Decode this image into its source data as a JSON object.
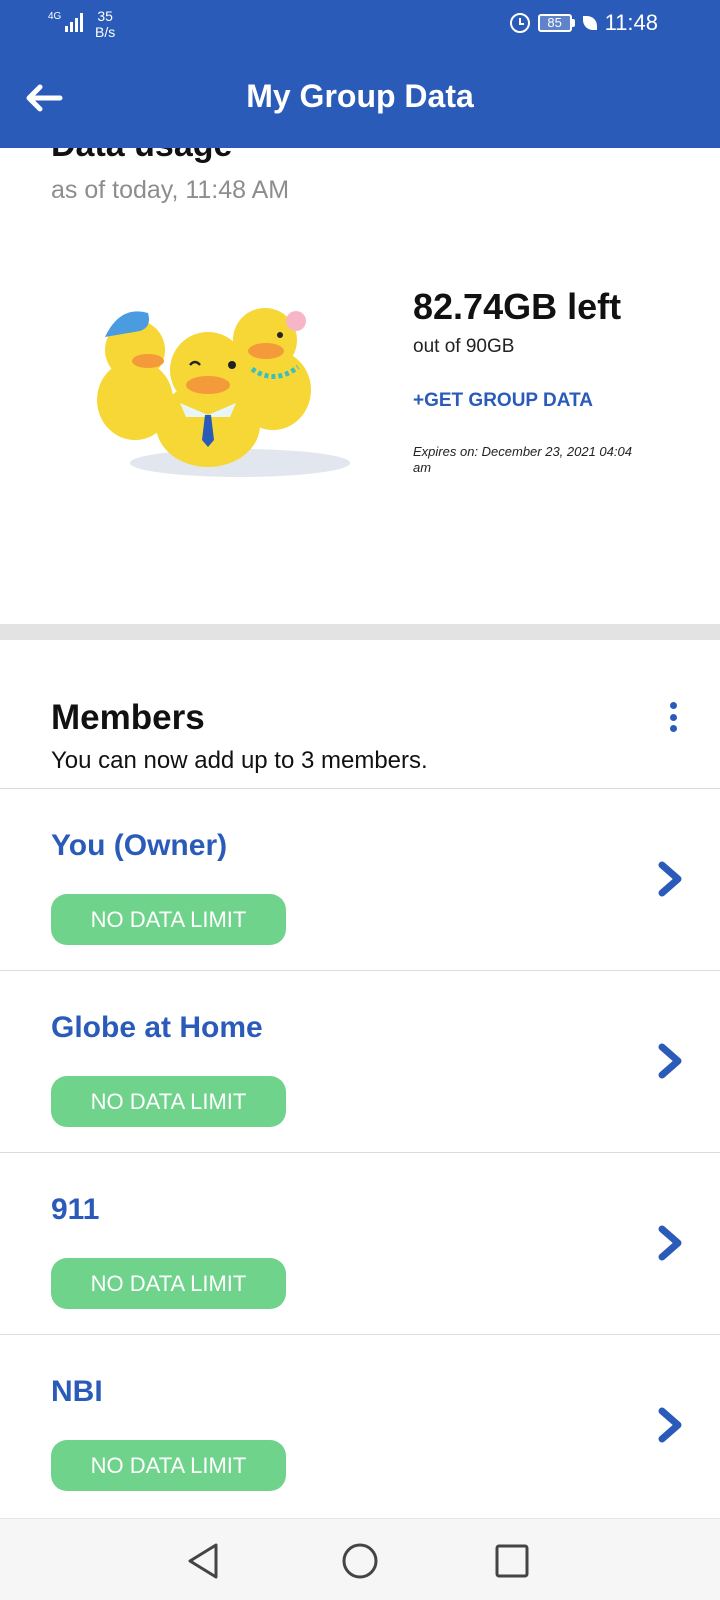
{
  "status_bar": {
    "network": "4G",
    "speed_value": "35",
    "speed_unit": "B/s",
    "battery": "85",
    "time": "11:48"
  },
  "app_bar": {
    "title": "My Group Data",
    "back_icon": "back-arrow-icon"
  },
  "usage": {
    "heading": "Data usage",
    "as_of": "as of today, 11:48 AM",
    "remaining": "82.74GB left",
    "total": "out of 90GB",
    "get_group_data": "+GET GROUP DATA",
    "expires": "Expires on: December 23, 2021 04:04 am"
  },
  "members": {
    "title": "Members",
    "subtitle": "You can now add up to 3 members.",
    "menu_icon": "more-vert-icon",
    "items": [
      {
        "name": "You (Owner)",
        "limit": "NO DATA LIMIT"
      },
      {
        "name": "Globe at Home",
        "limit": "NO DATA LIMIT"
      },
      {
        "name": "911",
        "limit": "NO DATA LIMIT"
      },
      {
        "name": "NBI",
        "limit": "NO DATA LIMIT"
      }
    ]
  },
  "nav": {
    "icons": [
      "back-triangle-icon",
      "home-circle-icon",
      "recents-square-icon"
    ]
  },
  "colors": {
    "brand_blue": "#2a5bb8",
    "badge_green": "#6fd38c",
    "duck_yellow": "#f6d735"
  }
}
